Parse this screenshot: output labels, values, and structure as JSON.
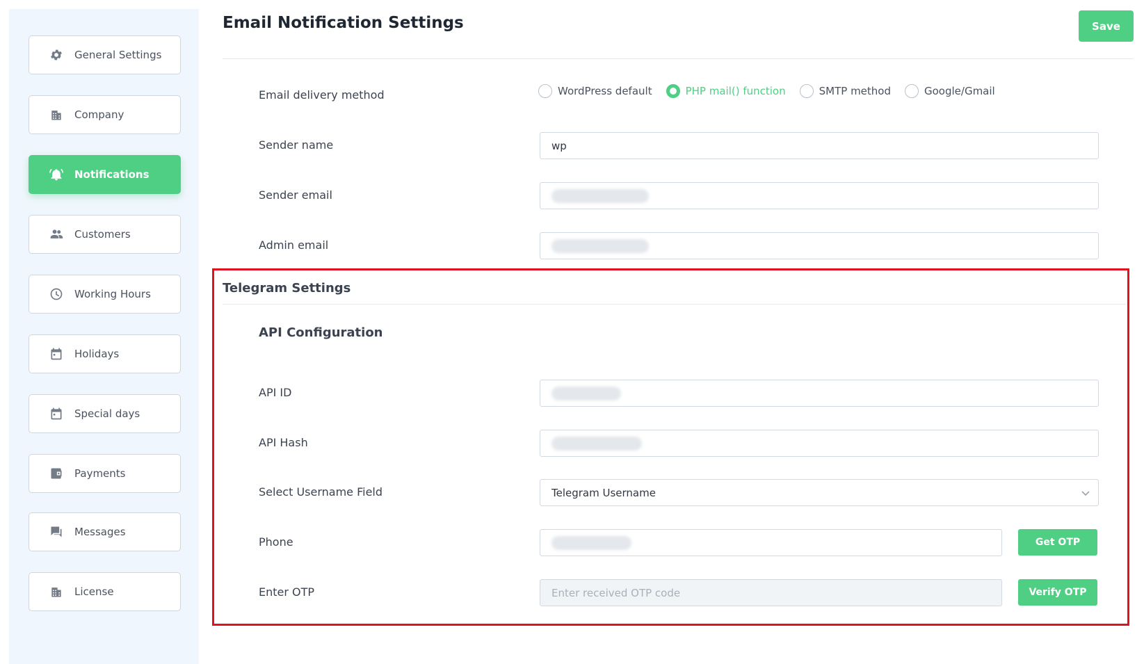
{
  "sidebar": {
    "items": [
      {
        "label": "General Settings",
        "icon": "gear-icon"
      },
      {
        "label": "Company",
        "icon": "building-icon"
      },
      {
        "label": "Notifications",
        "icon": "bell-icon",
        "active": true
      },
      {
        "label": "Customers",
        "icon": "users-icon"
      },
      {
        "label": "Working Hours",
        "icon": "clock-icon"
      },
      {
        "label": "Holidays",
        "icon": "calendar-icon"
      },
      {
        "label": "Special days",
        "icon": "calendar-icon"
      },
      {
        "label": "Payments",
        "icon": "wallet-icon"
      },
      {
        "label": "Messages",
        "icon": "chat-icon"
      },
      {
        "label": "License",
        "icon": "building-icon"
      }
    ]
  },
  "header": {
    "title": "Email Notification Settings",
    "save_label": "Save"
  },
  "email": {
    "delivery_label": "Email delivery method",
    "delivery_options": [
      "WordPress default",
      "PHP mail() function",
      "SMTP method",
      "Google/Gmail"
    ],
    "delivery_selected": "PHP mail() function",
    "sender_name_label": "Sender name",
    "sender_name_value": "wp",
    "sender_email_label": "Sender email",
    "admin_email_label": "Admin email"
  },
  "telegram": {
    "section_title": "Telegram Settings",
    "api_config_title": "API Configuration",
    "api_id_label": "API ID",
    "api_hash_label": "API Hash",
    "username_field_label": "Select Username Field",
    "username_field_value": "Telegram Username",
    "phone_label": "Phone",
    "get_otp_label": "Get OTP",
    "otp_label": "Enter OTP",
    "otp_placeholder": "Enter received OTP code",
    "verify_otp_label": "Verify OTP"
  },
  "colors": {
    "accent": "#4fcf84",
    "highlight_border": "#e0121e"
  }
}
